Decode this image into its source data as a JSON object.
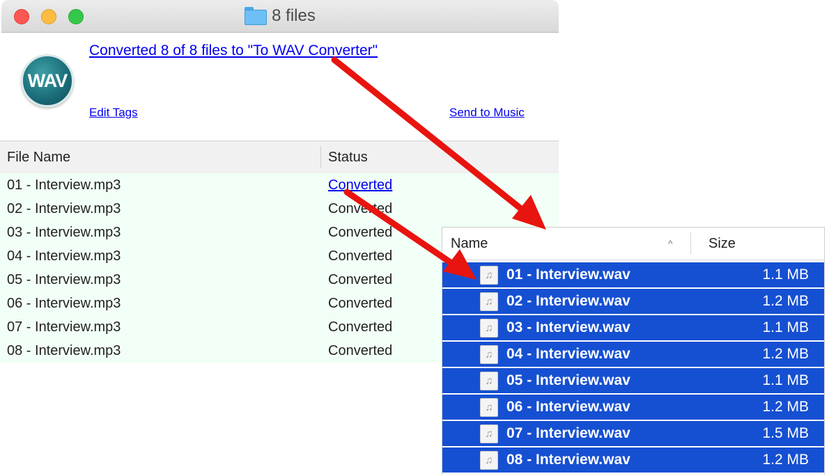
{
  "window": {
    "title": "8 files",
    "summary_link": "Converted 8 of 8 files to \"To WAV Converter\"",
    "edit_tags": "Edit Tags",
    "send_to_music": "Send to Music",
    "logo_text": "WAV",
    "icons": {
      "folder": "folder-icon",
      "logo": "wav-logo"
    }
  },
  "table": {
    "columns": {
      "name": "File Name",
      "status": "Status"
    },
    "rows": [
      {
        "name": "01 - Interview.mp3",
        "status": "Converted",
        "linked": true
      },
      {
        "name": "02 - Interview.mp3",
        "status": "Converted",
        "linked": false
      },
      {
        "name": "03 - Interview.mp3",
        "status": "Converted",
        "linked": false
      },
      {
        "name": "04 - Interview.mp3",
        "status": "Converted",
        "linked": false
      },
      {
        "name": "05 - Interview.mp3",
        "status": "Converted",
        "linked": false
      },
      {
        "name": "06 - Interview.mp3",
        "status": "Converted",
        "linked": false
      },
      {
        "name": "07 - Interview.mp3",
        "status": "Converted",
        "linked": false
      },
      {
        "name": "08 - Interview.mp3",
        "status": "Converted",
        "linked": false
      }
    ]
  },
  "finder": {
    "columns": {
      "name": "Name",
      "size": "Size",
      "sort_indicator": "^"
    },
    "file_icon_glyph": "♫",
    "files": [
      {
        "name": "01 - Interview.wav",
        "size": "1.1 MB"
      },
      {
        "name": "02 - Interview.wav",
        "size": "1.2 MB"
      },
      {
        "name": "03 - Interview.wav",
        "size": "1.1 MB"
      },
      {
        "name": "04 - Interview.wav",
        "size": "1.2 MB"
      },
      {
        "name": "05 - Interview.wav",
        "size": "1.1 MB"
      },
      {
        "name": "06 - Interview.wav",
        "size": "1.2 MB"
      },
      {
        "name": "07 - Interview.wav",
        "size": "1.5 MB"
      },
      {
        "name": "08 - Interview.wav",
        "size": "1.2 MB"
      }
    ]
  },
  "colors": {
    "selection": "#1650d2",
    "link": "#0000ee",
    "arrow": "#e8140f",
    "row_background": "#f2fff6"
  }
}
